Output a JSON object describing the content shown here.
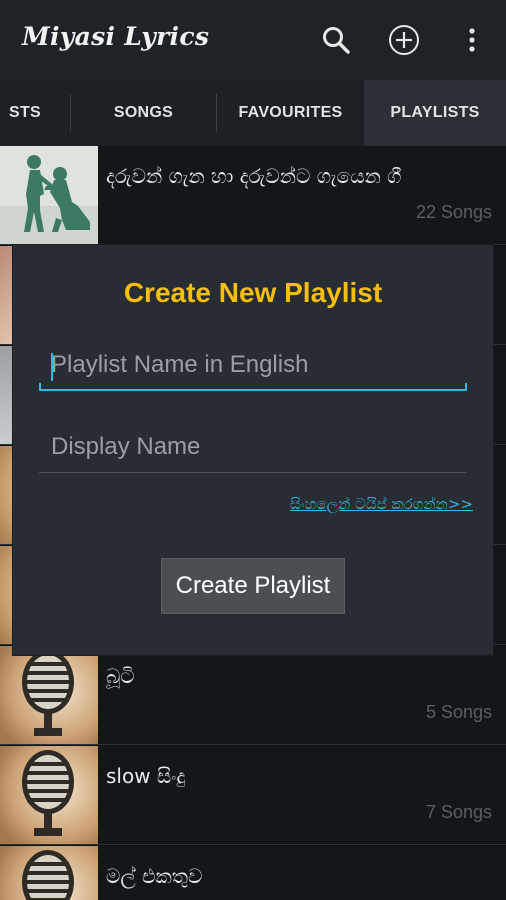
{
  "app": {
    "title": "Miyasi Lyrics"
  },
  "toolbar": {
    "search_icon": "search-icon",
    "add_icon": "add-circle-icon",
    "menu_icon": "overflow-menu-icon"
  },
  "tabs": [
    {
      "label": "STS",
      "active": false
    },
    {
      "label": "SONGS",
      "active": false
    },
    {
      "label": "FAVOURITES",
      "active": false
    },
    {
      "label": "PLAYLISTS",
      "active": true
    }
  ],
  "playlists": [
    {
      "title": "දරුවන් ගැන හා දරුවන්ට ගැයෙන ගී",
      "count": "22 Songs",
      "thumb": "mother-child-silhouette"
    },
    {
      "title": "",
      "count": "",
      "thumb": "photo"
    },
    {
      "title": "",
      "count": "",
      "thumb": "photo"
    },
    {
      "title": "",
      "count": "",
      "thumb": "microphone"
    },
    {
      "title": "",
      "count": "",
      "thumb": "microphone"
    },
    {
      "title": "බූටි",
      "count": "5 Songs",
      "thumb": "microphone"
    },
    {
      "title": "slow සිංදු",
      "count": "7 Songs",
      "thumb": "microphone"
    },
    {
      "title": "මල් එකතුව",
      "count": "",
      "thumb": "microphone"
    }
  ],
  "dialog": {
    "title": "Create New Playlist",
    "english_name_placeholder": "Playlist Name in English",
    "display_name_placeholder": "Display Name",
    "sinhala_link": "සිංහලෙන් ටයිප් කරගන්න>>",
    "create_button": "Create Playlist"
  },
  "colors": {
    "accent": "#f6be12",
    "link": "#33b5e5",
    "background": "#111417"
  }
}
